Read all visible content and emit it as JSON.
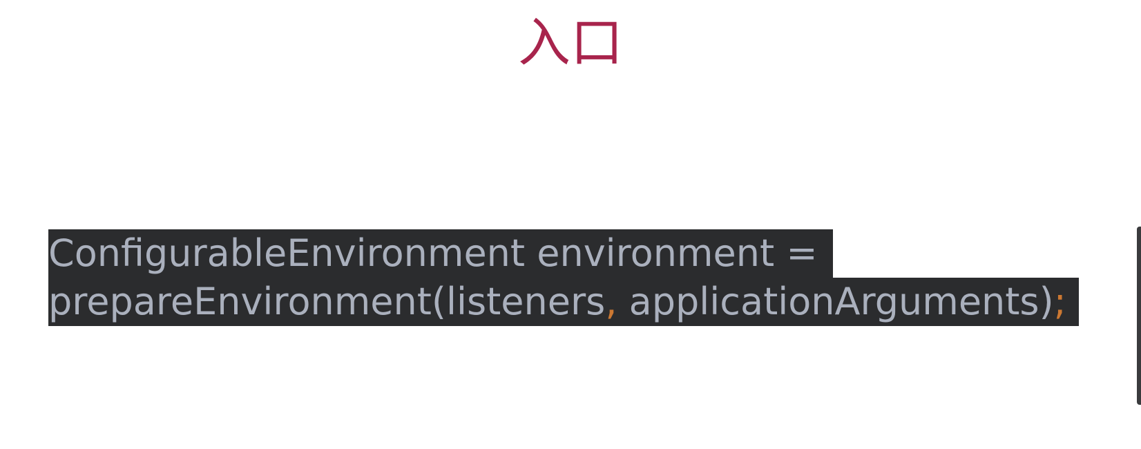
{
  "title": "入口",
  "code": {
    "line1": "ConfigurableEnvironment environment =",
    "line2_call": "prepareEnvironment(listeners",
    "line2_comma": ",",
    "line2_args": " applicationArguments)",
    "line2_semicolon": ";"
  },
  "colors": {
    "title": "#a8244c",
    "code_text": "#aab0bd",
    "code_background": "#2b2c2e",
    "punctuation": "#cc7832"
  }
}
